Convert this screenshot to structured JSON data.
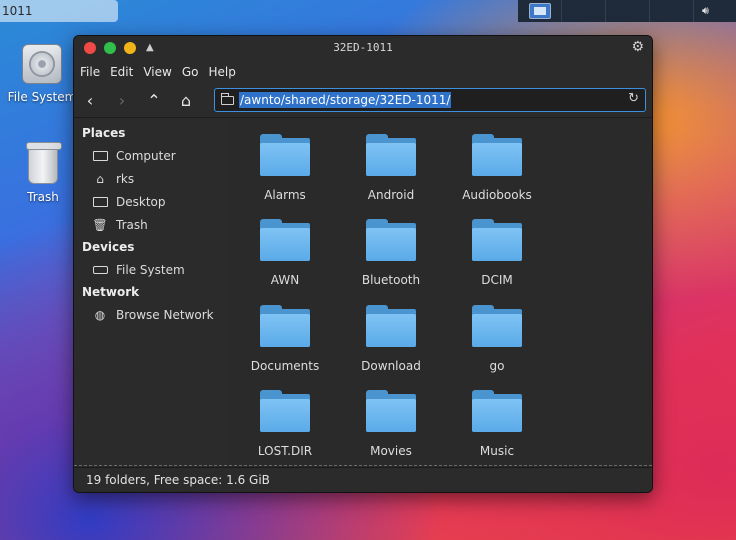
{
  "taskbar": {
    "entry_label": "1011"
  },
  "desktop": {
    "icons": [
      {
        "label": "File System",
        "icon": "hard-drive-icon"
      },
      {
        "label": "Trash",
        "icon": "trash-can-icon"
      }
    ]
  },
  "window": {
    "title": "32ED-1011",
    "menu": [
      "File",
      "Edit",
      "View",
      "Go",
      "Help"
    ],
    "address": "/awnto/shared/storage/32ED-1011/",
    "sidebar": {
      "places_header": "Places",
      "places": [
        {
          "label": "Computer",
          "icon": "computer-icon"
        },
        {
          "label": "rks",
          "icon": "home-icon"
        },
        {
          "label": "Desktop",
          "icon": "desktop-icon"
        },
        {
          "label": "Trash",
          "icon": "trash-icon"
        }
      ],
      "devices_header": "Devices",
      "devices": [
        {
          "label": "File System",
          "icon": "drive-icon"
        }
      ],
      "network_header": "Network",
      "network": [
        {
          "label": "Browse Network",
          "icon": "network-icon"
        }
      ]
    },
    "folders": [
      "Alarms",
      "Android",
      "Audiobooks",
      "AWN",
      "Bluetooth",
      "DCIM",
      "Documents",
      "Download",
      "go",
      "LOST.DIR",
      "Movies",
      "Music"
    ],
    "status": "19 folders, Free space: 1.6 GiB"
  }
}
